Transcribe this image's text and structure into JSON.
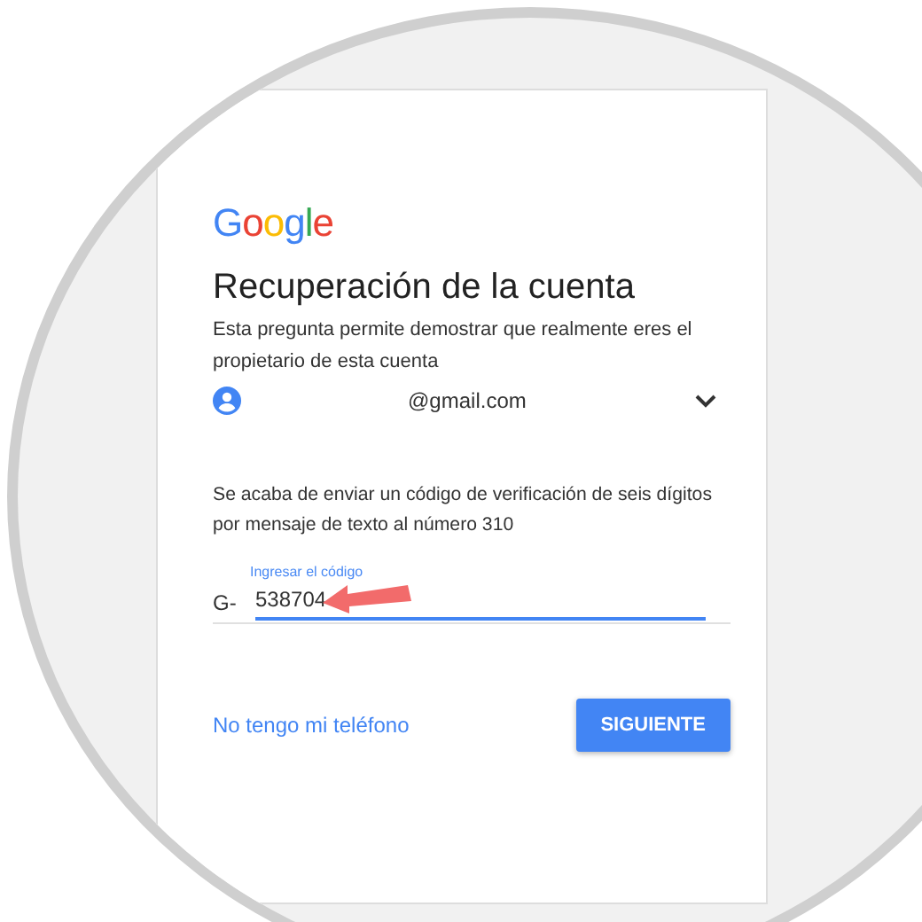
{
  "logo": "Google",
  "title": "Recuperación de la cuenta",
  "description": "Esta pregunta permite demostrar que realmente eres el propietario de esta cuenta",
  "account": {
    "email": "@gmail.com",
    "expanded": false
  },
  "instruction": "Se acaba de enviar un código de verificación de seis dígitos por mensaje de texto al número 310",
  "code_field": {
    "placeholder": "Ingresar el código",
    "prefix": "G-",
    "value": "538704",
    "focused": true
  },
  "link": "No tengo mi teléfono",
  "button": "SIGUIENTE"
}
